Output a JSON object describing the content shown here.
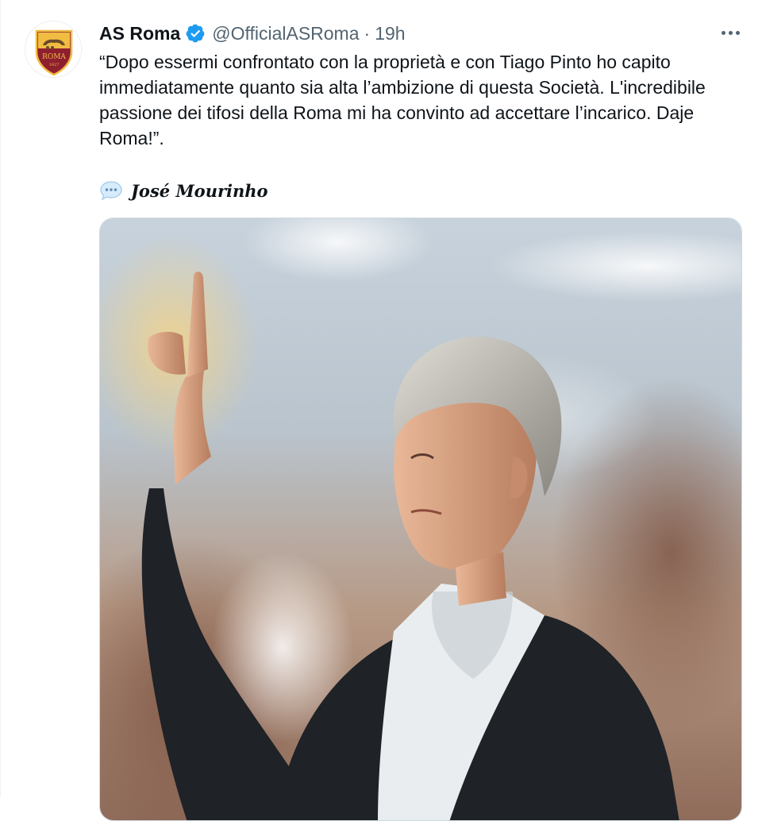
{
  "tweet": {
    "author_name": "AS Roma",
    "handle": "@OfficialASRoma",
    "separator": "·",
    "time": "19h",
    "text": "“Dopo essermi confrontato con la proprietà e con Tiago Pinto ho capito immediatamente quanto sia alta l’ambizione di questa Società. L'incredibile passione dei tifosi della Roma mi ha convinto ad accettare l’incarico. Daje Roma!”.",
    "signature": "José Mourinho",
    "verified": true
  },
  "avatar": {
    "logo_text": "ROMA",
    "logo_year": "1927",
    "icon": "as-roma-crest-icon"
  },
  "icons": {
    "verified": "verified-badge-icon",
    "more": "more-options-icon",
    "speech": "speech-bubble-icon"
  },
  "colors": {
    "verified_blue": "#1d9bf0",
    "secondary_text": "#536471",
    "roma_crimson": "#8e1f2f",
    "roma_gold": "#f0bc42"
  }
}
